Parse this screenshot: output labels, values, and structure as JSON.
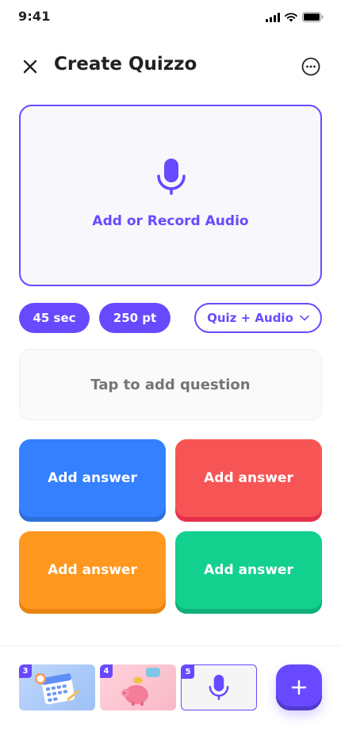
{
  "status_bar": {
    "time": "9:41"
  },
  "header": {
    "title": "Create Quizzo"
  },
  "audio": {
    "label": "Add or Record Audio"
  },
  "settings": {
    "time_limit": "45 sec",
    "points": "250 pt",
    "question_type": "Quiz + Audio"
  },
  "question": {
    "placeholder": "Tap to add question"
  },
  "answers": [
    {
      "label": "Add answer",
      "color": "#3580FF"
    },
    {
      "label": "Add answer",
      "color": "#F75555"
    },
    {
      "label": "Add answer",
      "color": "#FF981F"
    },
    {
      "label": "Add answer",
      "color": "#12D18E"
    }
  ],
  "slides": [
    {
      "number": "3",
      "icon": "calendar-illustration"
    },
    {
      "number": "4",
      "icon": "piggy-bank-illustration"
    },
    {
      "number": "5",
      "icon": "microphone-icon"
    }
  ],
  "colors": {
    "primary": "#6949FF"
  }
}
